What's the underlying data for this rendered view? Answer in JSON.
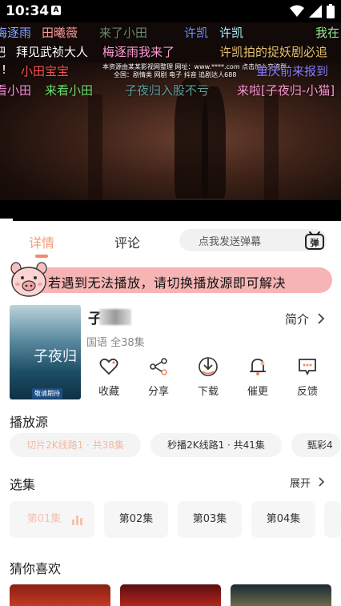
{
  "status_bar": {
    "time": "10:34",
    "notification_icon": "A"
  },
  "video": {
    "danmaku": [
      {
        "text": "梅逐雨",
        "color": "#8aa7ff"
      },
      {
        "text": "田曦薇",
        "color": "#ff9a9a"
      },
      {
        "text": "来了小田",
        "color": "#6f8a6f"
      },
      {
        "text": "许凯",
        "color": "#7c8cff"
      },
      {
        "text": "许凯",
        "color": "#aaf0ff"
      },
      {
        "text": "我在",
        "color": "#9ff09f"
      },
      {
        "text": "吧",
        "color": "#ffffff"
      },
      {
        "text": "拜见武祯大人",
        "color": "#ffffff"
      },
      {
        "text": "梅逐雨我来了",
        "color": "#ff9ad6"
      },
      {
        "text": "许凯拍的捉妖剧必追",
        "color": "#e8c070"
      },
      {
        "text": "!",
        "color": "#ffffff"
      },
      {
        "text": "小田宝宝",
        "color": "#ff4f4f"
      },
      {
        "text": "重庆前来报到",
        "color": "#8a7cff"
      },
      {
        "text": "看小田",
        "color": "#ff8fd8"
      },
      {
        "text": "来看小田",
        "color": "#6fe06f"
      },
      {
        "text": "子夜归入股不亏",
        "color": "#5fa0a0"
      },
      {
        "text": "来啦[子夜归-小猫]",
        "color": "#ff9ad6"
      }
    ],
    "overlay_lines": [
      "本资源由某某影视网整理  网址：www.****.com  点击加入交流群",
      "全国：剧情类 网剧 电子 抖音 追剧达人688"
    ]
  },
  "tabs": [
    {
      "label": "详情",
      "active": true
    },
    {
      "label": "评论",
      "active": false
    }
  ],
  "danmu_input": {
    "placeholder": "点我发送弹幕",
    "send_icon_label": "弹"
  },
  "notice": {
    "text": "若遇到无法播放，请切换播放源即可解决"
  },
  "drama": {
    "title_prefix": "子",
    "meta": "国语 全38集",
    "intro_label": "简介",
    "poster_title": "子夜归",
    "poster_badge": "敬请期待"
  },
  "actions": [
    {
      "label": "收藏",
      "icon": "heart-icon"
    },
    {
      "label": "分享",
      "icon": "share-icon"
    },
    {
      "label": "下载",
      "icon": "download-icon"
    },
    {
      "label": "催更",
      "icon": "bell-icon"
    },
    {
      "label": "反馈",
      "icon": "feedback-icon"
    }
  ],
  "sources": {
    "title": "播放源",
    "items": [
      {
        "label": "切片2K线路1 · 共38集",
        "active": true
      },
      {
        "label": "秒播2K线路1 · 共41集",
        "active": false
      },
      {
        "label": "甄彩4",
        "active": false
      }
    ]
  },
  "episodes": {
    "title": "选集",
    "expand_label": "展开",
    "items": [
      {
        "label": "第01集",
        "active": true
      },
      {
        "label": "第02集",
        "active": false
      },
      {
        "label": "第03集",
        "active": false
      },
      {
        "label": "第04集",
        "active": false
      }
    ]
  },
  "recommend": {
    "title": "猜你喜欢"
  },
  "colors": {
    "accent": "#f08a6a",
    "notice_bg": "#f6b4b4"
  }
}
